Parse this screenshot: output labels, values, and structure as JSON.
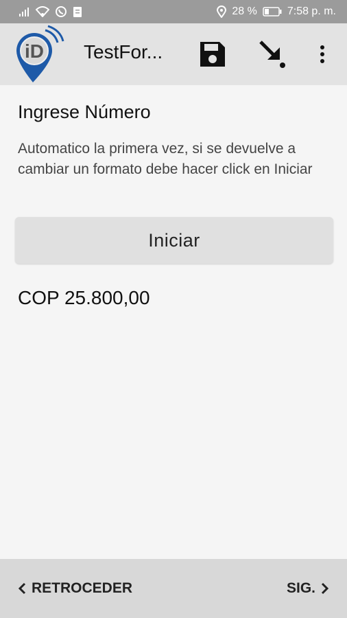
{
  "status_bar": {
    "battery": "28 %",
    "time": "7:58 p. m.",
    "icons": [
      "signal-icon",
      "wifi-icon",
      "whatsapp-icon",
      "clipboard-icon",
      "location-icon",
      "battery-icon"
    ]
  },
  "app_bar": {
    "title": "TestFor...",
    "logo_text": "iD",
    "actions": [
      "save-icon",
      "download-icon",
      "more-vert-icon"
    ]
  },
  "form": {
    "label": "Ingrese Número",
    "help": "Automatico la primera vez, si se devuelve a cambiar un formato debe hacer click en Iniciar",
    "start_button": "Iniciar",
    "value": "COP 25.800,00"
  },
  "bottom_nav": {
    "back_label": "RETROCEDER",
    "next_label": "SIG."
  },
  "colors": {
    "status_bar": "#9b9b9b",
    "app_bar": "#e3e3e3",
    "background": "#f5f5f5",
    "button": "#e0e0e0",
    "bottom_bar": "#d8d8d8",
    "logo_blue": "#1e5aa8"
  }
}
